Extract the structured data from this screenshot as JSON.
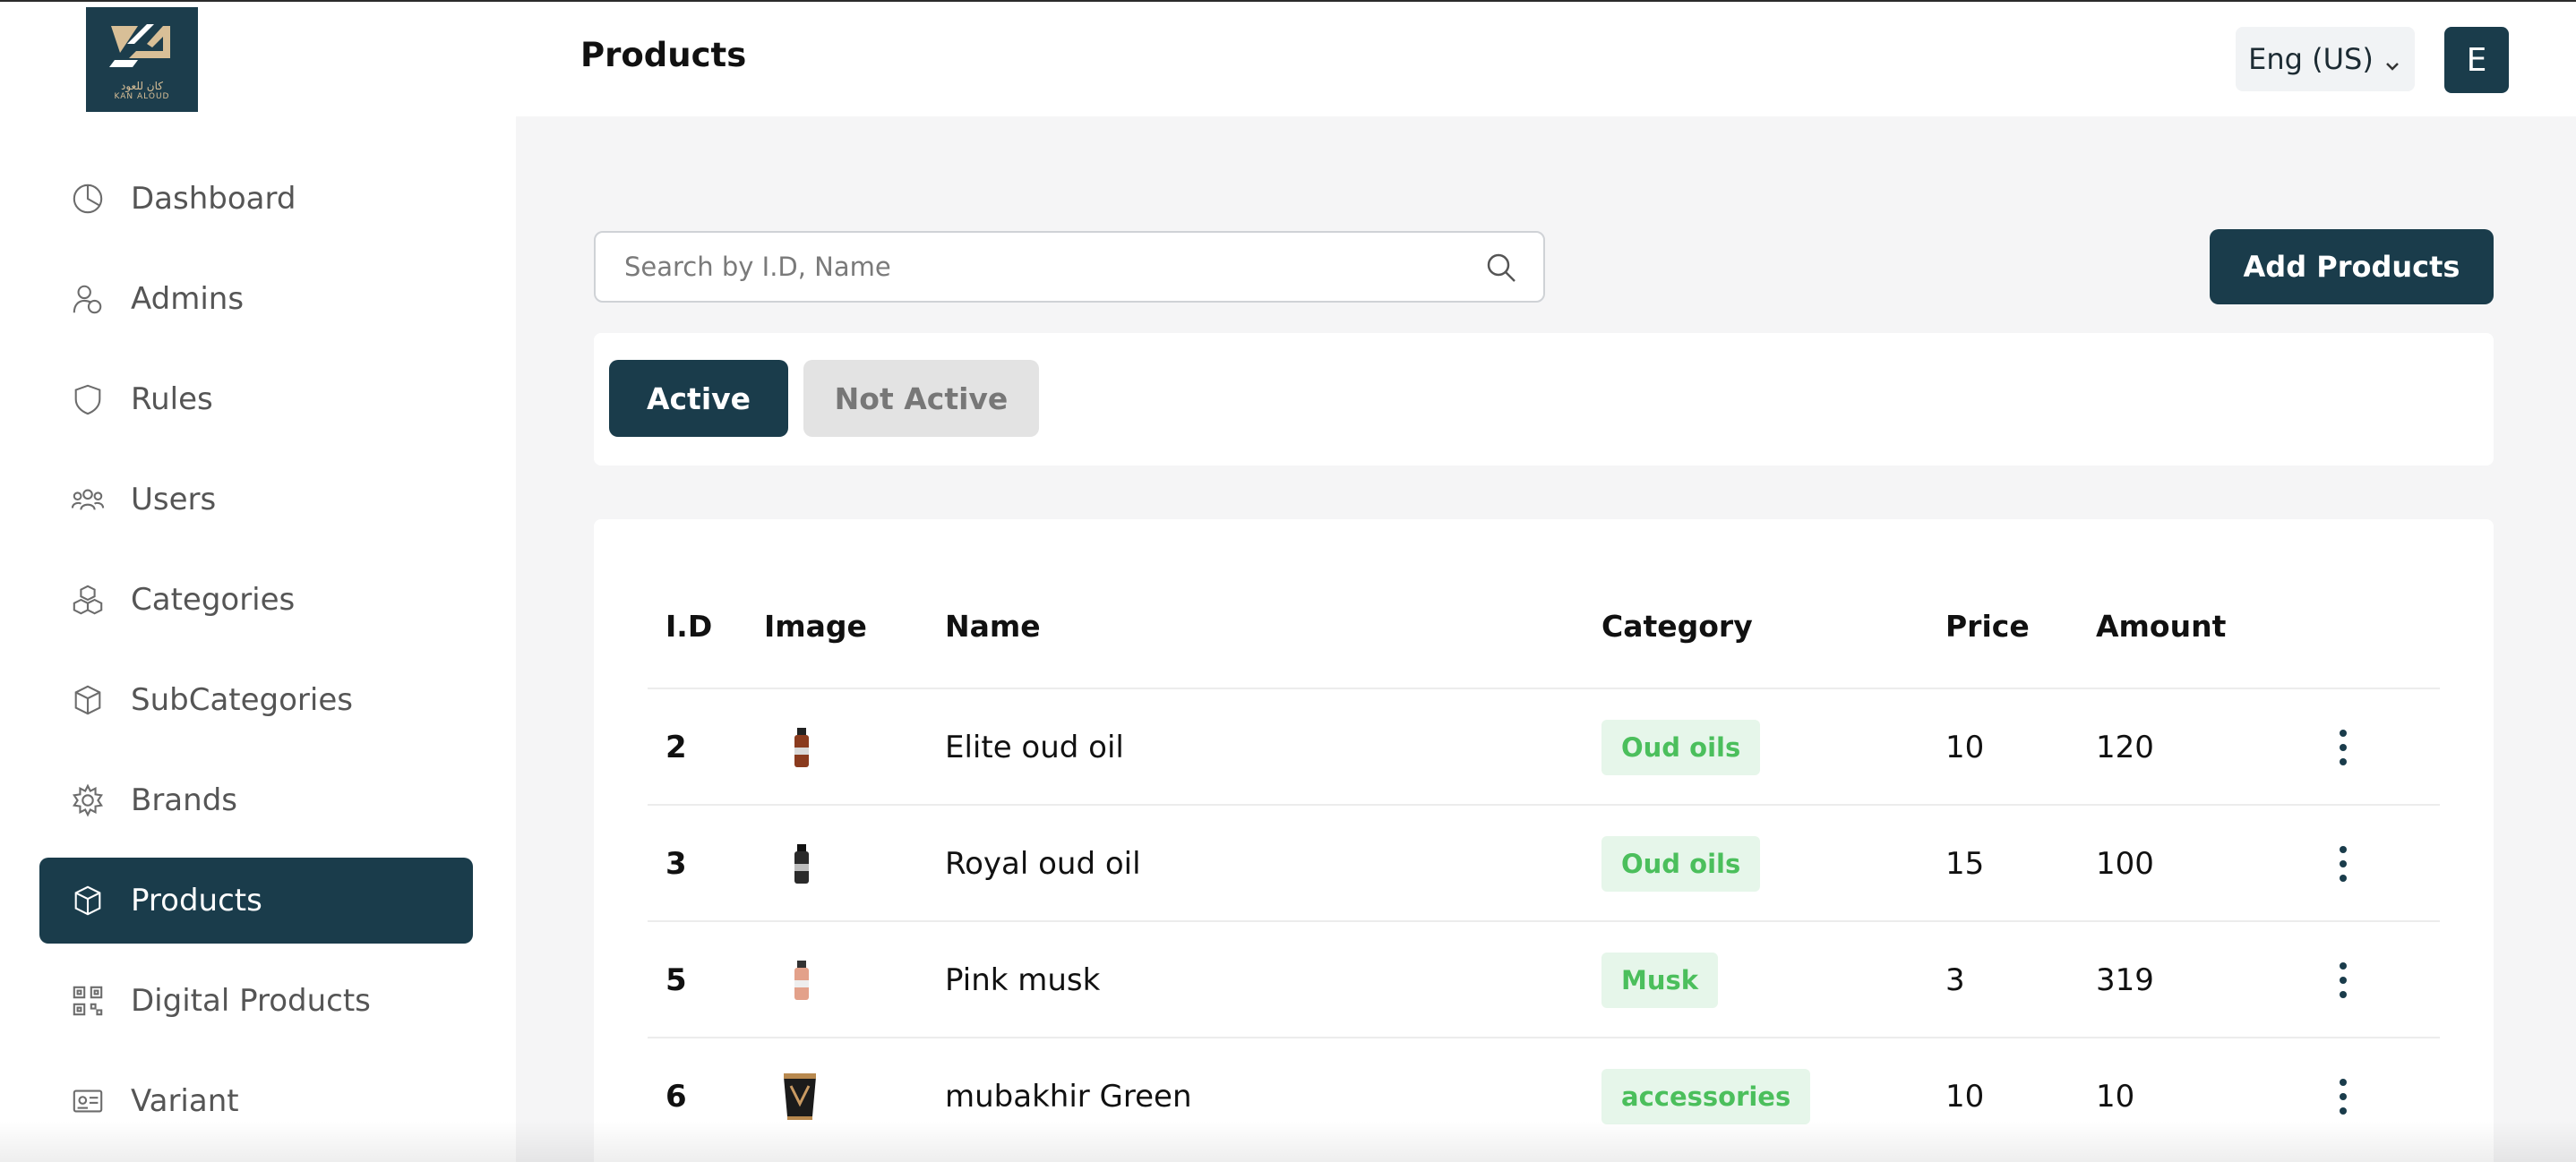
{
  "brand": {
    "logo_text_ar": "كان للعود",
    "logo_text_en": "KAN ALOUD",
    "colors": {
      "primary": "#1a3c4b",
      "logo_gold": "#d8bf97",
      "badge_text": "#4bbf5c",
      "badge_bg": "#e6f6ea"
    }
  },
  "sidebar": {
    "items": [
      {
        "label": "Dashboard",
        "icon": "pie-chart-icon"
      },
      {
        "label": "Admins",
        "icon": "admin-user-icon"
      },
      {
        "label": "Rules",
        "icon": "shield-icon"
      },
      {
        "label": "Users",
        "icon": "users-group-icon"
      },
      {
        "label": "Categories",
        "icon": "boxes-icon"
      },
      {
        "label": "SubCategories",
        "icon": "cube-icon"
      },
      {
        "label": "Brands",
        "icon": "gear-badge-icon"
      },
      {
        "label": "Products",
        "icon": "cube-icon",
        "active": true
      },
      {
        "label": "Digital Products",
        "icon": "qr-code-icon"
      },
      {
        "label": "Variant",
        "icon": "id-card-icon"
      }
    ]
  },
  "header": {
    "title": "Products",
    "language": "Eng (US)",
    "avatar_initial": "E"
  },
  "toolbar": {
    "search_placeholder": "Search by I.D, Name",
    "add_label": "Add Products"
  },
  "filters": {
    "active_label": "Active",
    "inactive_label": "Not Active"
  },
  "table": {
    "columns": [
      "I.D",
      "Image",
      "Name",
      "Category",
      "Price",
      "Amount"
    ],
    "rows": [
      {
        "id": "2",
        "name": "Elite oud oil",
        "category": "Oud oils",
        "price": "10",
        "amount": "120",
        "image": "dark-bottle-image"
      },
      {
        "id": "3",
        "name": "Royal oud oil",
        "category": "Oud oils",
        "price": "15",
        "amount": "100",
        "image": "black-bottle-image"
      },
      {
        "id": "5",
        "name": "Pink musk",
        "category": "Musk",
        "price": "3",
        "amount": "319",
        "image": "pink-bottle-image"
      },
      {
        "id": "6",
        "name": "mubakhir Green",
        "category": "accessories",
        "price": "10",
        "amount": "10",
        "image": "incense-burner-image"
      }
    ]
  }
}
